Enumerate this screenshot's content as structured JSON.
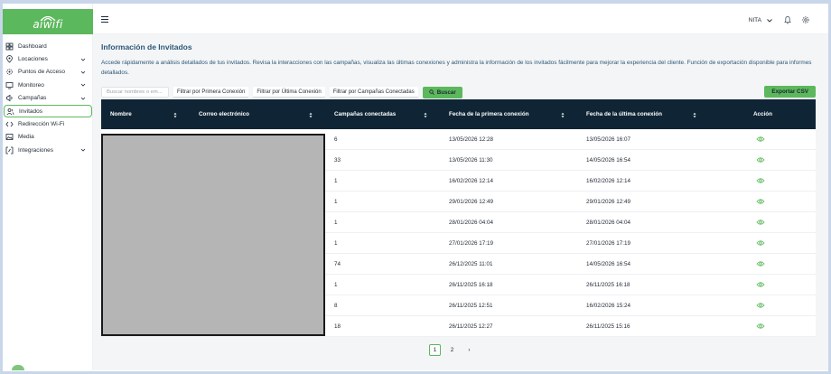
{
  "app": {
    "logo_text": "aiwifi",
    "brand_color": "#5cb85c",
    "header_color": "#0f2535"
  },
  "sidebar": {
    "items": [
      {
        "label": "Dashboard",
        "icon": "dashboard-icon",
        "chevron": false,
        "active": false
      },
      {
        "label": "Locaciones",
        "icon": "location-pin-icon",
        "chevron": true,
        "active": false
      },
      {
        "label": "Puntos de Acceso",
        "icon": "settings-icon",
        "chevron": true,
        "active": false
      },
      {
        "label": "Monitoreo",
        "icon": "monitor-icon",
        "chevron": true,
        "active": false
      },
      {
        "label": "Campañas",
        "icon": "megaphone-icon",
        "chevron": true,
        "active": false
      },
      {
        "label": "Invitados",
        "icon": "users-icon",
        "chevron": false,
        "active": true
      },
      {
        "label": "Redirección Wi-Fi",
        "icon": "code-icon",
        "chevron": false,
        "active": false
      },
      {
        "label": "Media",
        "icon": "media-icon",
        "chevron": false,
        "active": false
      },
      {
        "label": "Integraciones",
        "icon": "integrations-icon",
        "chevron": true,
        "active": false
      }
    ]
  },
  "topbar": {
    "user_name": "NITA"
  },
  "page": {
    "title": "Información de Invitados",
    "description": "Accede rápidamente a análisis detallados de tus invitados. Revisa la interacciones con las campañas, visualiza las últimas conexiones y administra la información de los invitados fácilmente para mejorar la experiencia del cliente. Función de exportación disponible para informes detallados."
  },
  "filters": {
    "search_placeholder": "Buscar nombres o em...",
    "first_connection": "Filtrar por Primera Conexión",
    "last_connection": "Filtrar por Última Conexión",
    "campaigns": "Filtrar por Campañas Conectadas",
    "search_button": "Buscar",
    "export_button": "Exportar CSV"
  },
  "table": {
    "columns": [
      "Nombre",
      "Correo electrónico",
      "Campañas conectadas",
      "Fecha de la primera conexión",
      "Fecha de la última conexión",
      "Acción"
    ],
    "rows": [
      {
        "campaigns": "6",
        "first": "13/05/2026 12:28",
        "last": "13/05/2026 16:07"
      },
      {
        "campaigns": "33",
        "first": "13/05/2026 11:30",
        "last": "14/05/2026 16:54"
      },
      {
        "campaigns": "1",
        "first": "16/02/2026 12:14",
        "last": "16/02/2026 12:14"
      },
      {
        "campaigns": "1",
        "first": "29/01/2026 12:49",
        "last": "29/01/2026 12:49"
      },
      {
        "campaigns": "1",
        "first": "28/01/2026 04:04",
        "last": "28/01/2026 04:04"
      },
      {
        "campaigns": "1",
        "first": "27/01/2026 17:19",
        "last": "27/01/2026 17:19"
      },
      {
        "campaigns": "74",
        "first": "26/12/2025 11:01",
        "last": "14/05/2026 16:54"
      },
      {
        "campaigns": "1",
        "first": "26/11/2025 16:18",
        "last": "26/11/2025 16:18"
      },
      {
        "campaigns": "8",
        "first": "26/11/2025 12:51",
        "last": "16/02/2026 15:24"
      },
      {
        "campaigns": "18",
        "first": "26/11/2025 12:27",
        "last": "26/11/2025 15:16"
      }
    ]
  },
  "pagination": {
    "prev": "‹",
    "next": "›",
    "pages": [
      "1",
      "2"
    ],
    "current": "1"
  }
}
